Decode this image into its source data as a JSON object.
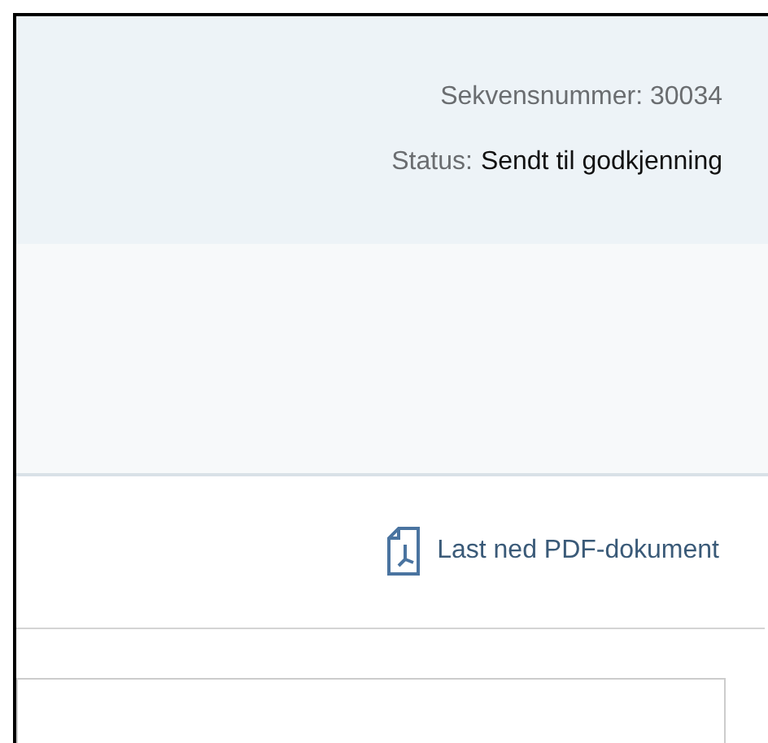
{
  "header": {
    "sequence": "Sekvensnummer: 30034",
    "status_label": "Status:",
    "status_value": "Sendt til godkjenning"
  },
  "download_link": {
    "label": "Last ned PDF-dokument"
  }
}
